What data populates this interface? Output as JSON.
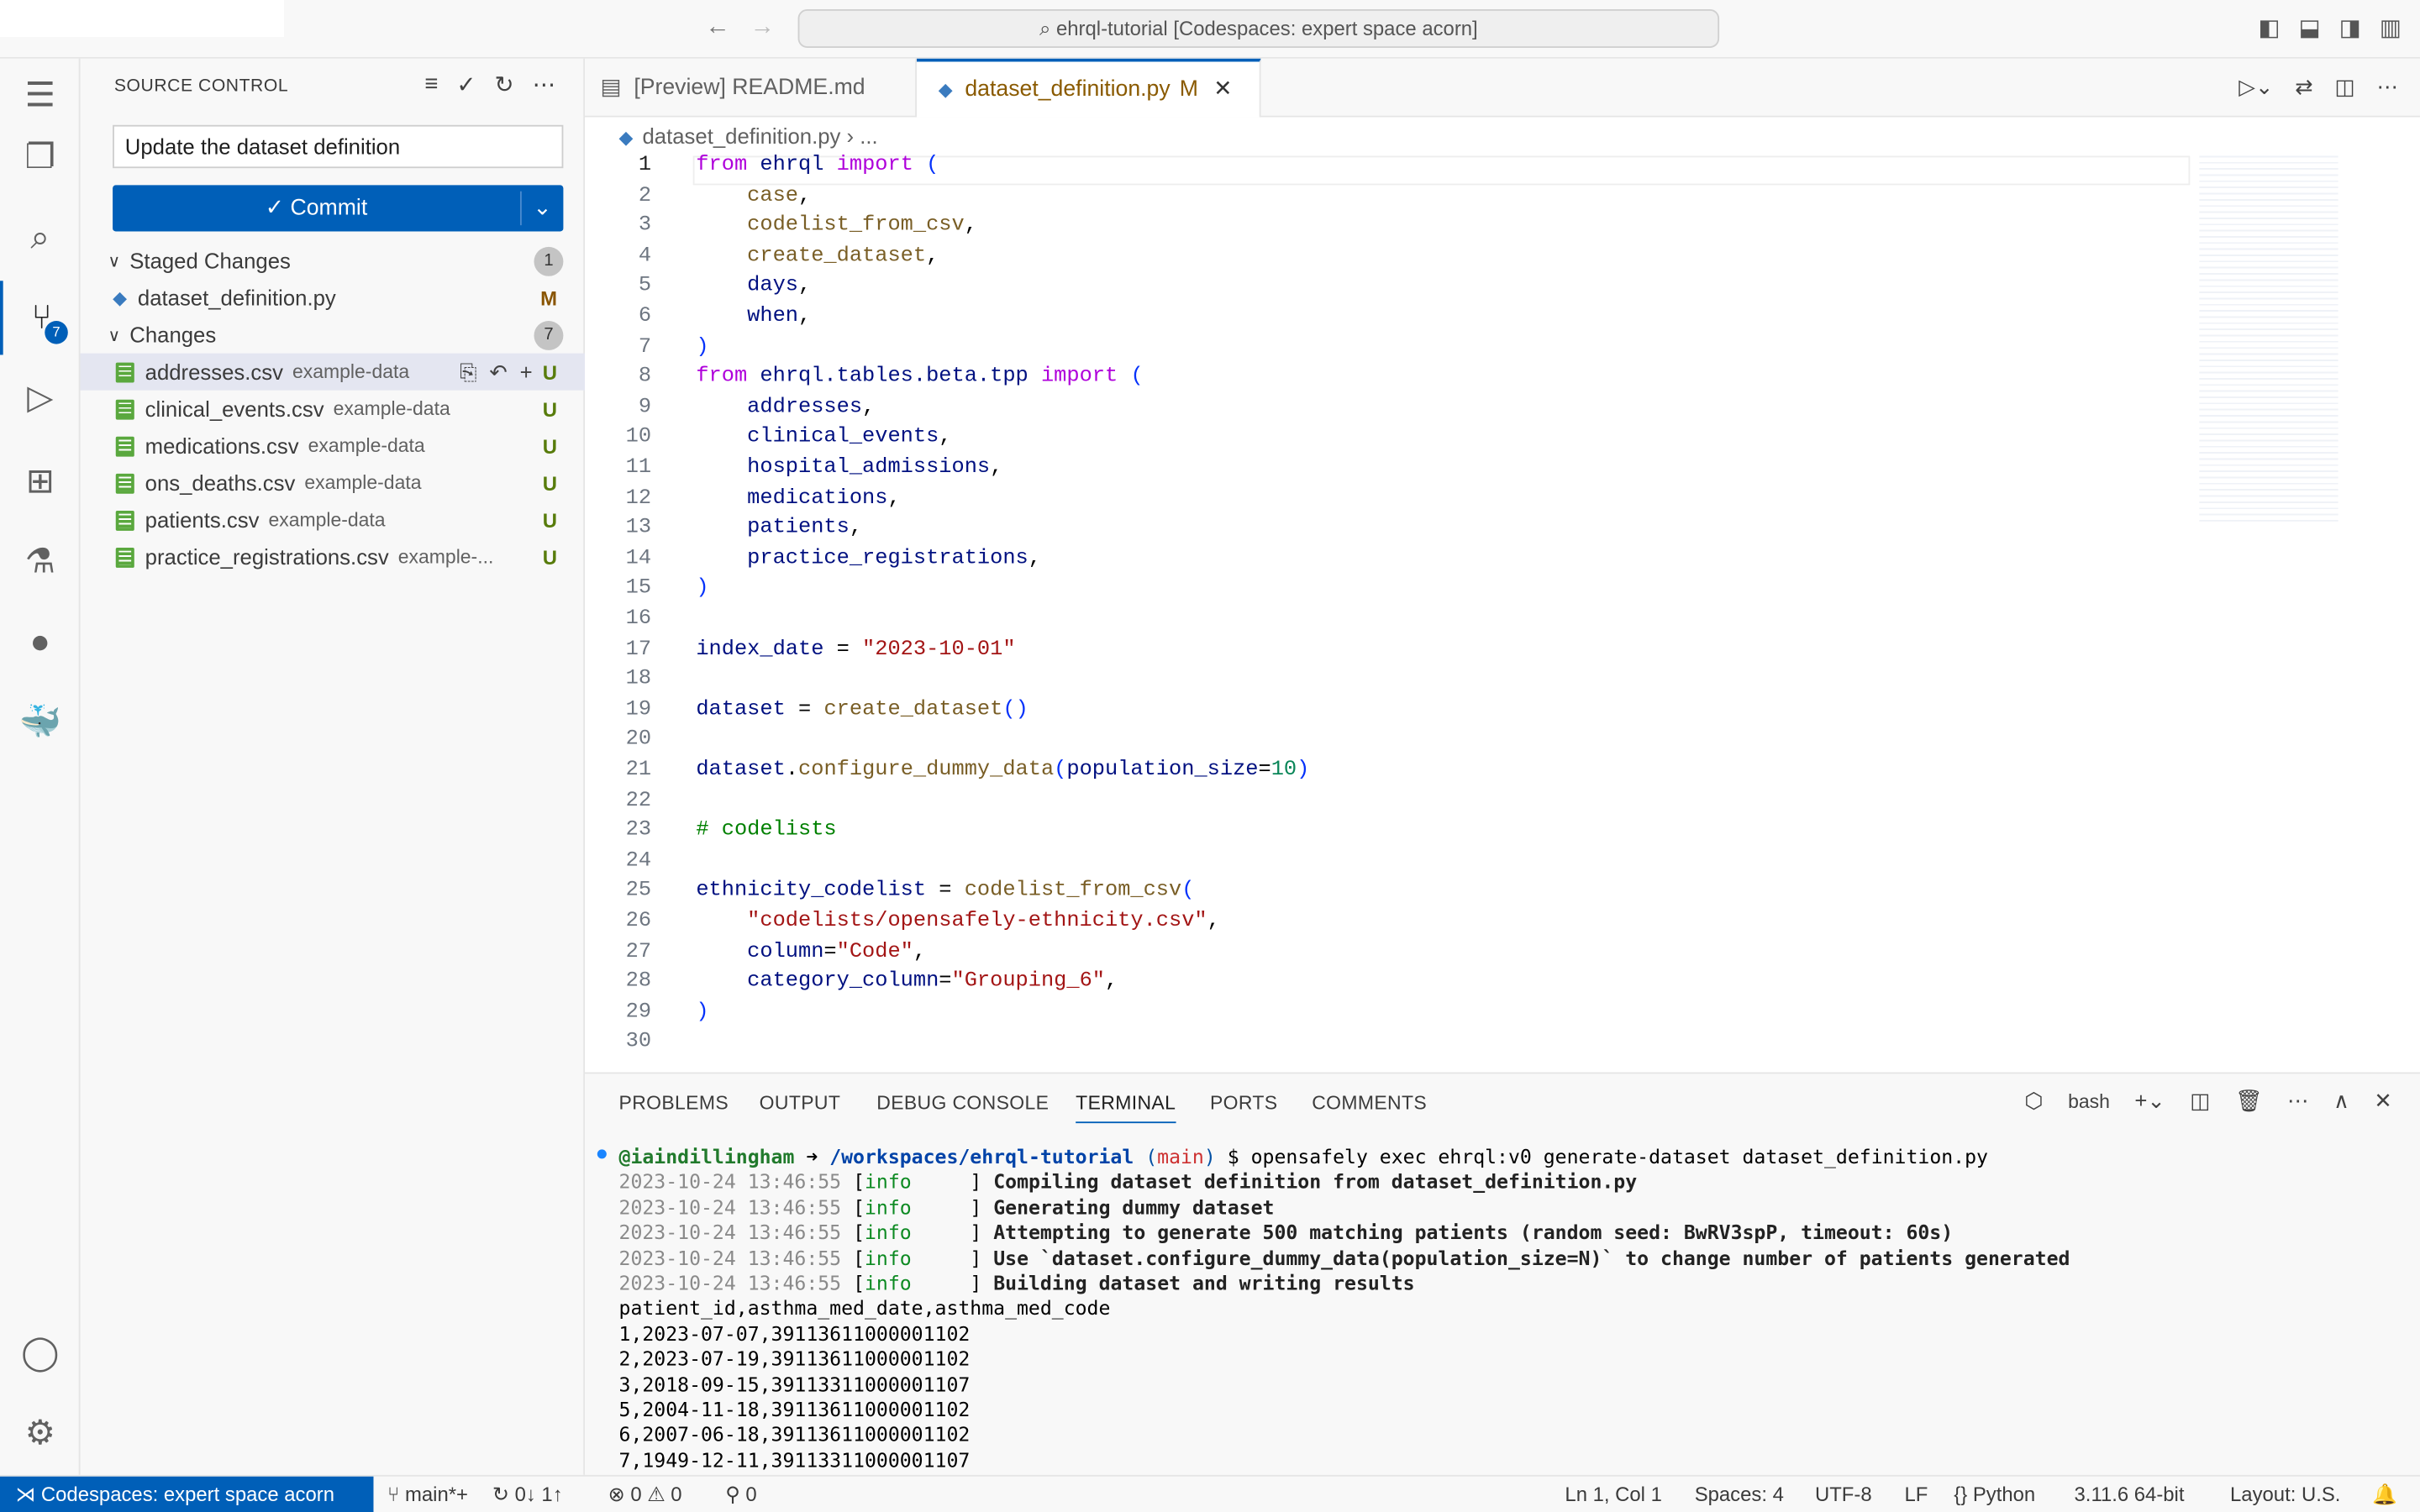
{
  "title_bar": {
    "search": "ehrql-tutorial [Codespaces: expert space acorn]"
  },
  "activity_bar": {
    "items": [
      "menu",
      "explorer",
      "search",
      "source-control",
      "run-debug",
      "extensions",
      "testing",
      "github",
      "docker",
      "accounts",
      "manage"
    ],
    "scm_badge": "7"
  },
  "sidebar": {
    "title": "SOURCE CONTROL",
    "commit_message": "Update the dataset definition",
    "commit_label": "Commit",
    "staged": {
      "label": "Staged Changes",
      "count": "1",
      "files": [
        {
          "name": "dataset_definition.py",
          "dir": "",
          "status": "M"
        }
      ]
    },
    "changes": {
      "label": "Changes",
      "count": "7",
      "files": [
        {
          "name": "addresses.csv",
          "dir": "example-data",
          "status": "U"
        },
        {
          "name": "clinical_events.csv",
          "dir": "example-data",
          "status": "U"
        },
        {
          "name": "medications.csv",
          "dir": "example-data",
          "status": "U"
        },
        {
          "name": "ons_deaths.csv",
          "dir": "example-data",
          "status": "U"
        },
        {
          "name": "patients.csv",
          "dir": "example-data",
          "status": "U"
        },
        {
          "name": "practice_registrations.csv",
          "dir": "example-...",
          "status": "U"
        }
      ]
    }
  },
  "tabs": [
    {
      "label": "[Preview] README.md"
    },
    {
      "label": "dataset_definition.py",
      "modified": "M"
    }
  ],
  "breadcrumb": {
    "file": "dataset_definition.py",
    "rest": "..."
  },
  "code": [
    [
      [
        "from ",
        "kw"
      ],
      [
        "ehrql ",
        "var"
      ],
      [
        "import ",
        "kw"
      ],
      [
        "(",
        "par"
      ]
    ],
    [
      [
        "    case",
        "fn"
      ],
      [
        ",",
        "pl"
      ]
    ],
    [
      [
        "    codelist_from_csv",
        "fn"
      ],
      [
        ",",
        "pl"
      ]
    ],
    [
      [
        "    create_dataset",
        "fn"
      ],
      [
        ",",
        "pl"
      ]
    ],
    [
      [
        "    days",
        "var"
      ],
      [
        ",",
        "pl"
      ]
    ],
    [
      [
        "    when",
        "var"
      ],
      [
        ",",
        "pl"
      ]
    ],
    [
      [
        ")",
        "par"
      ]
    ],
    [
      [
        "from ",
        "kw"
      ],
      [
        "ehrql.tables.beta.tpp ",
        "var"
      ],
      [
        "import ",
        "kw"
      ],
      [
        "(",
        "par"
      ]
    ],
    [
      [
        "    addresses",
        "var"
      ],
      [
        ",",
        "pl"
      ]
    ],
    [
      [
        "    clinical_events",
        "var"
      ],
      [
        ",",
        "pl"
      ]
    ],
    [
      [
        "    hospital_admissions",
        "var"
      ],
      [
        ",",
        "pl"
      ]
    ],
    [
      [
        "    medications",
        "var"
      ],
      [
        ",",
        "pl"
      ]
    ],
    [
      [
        "    patients",
        "var"
      ],
      [
        ",",
        "pl"
      ]
    ],
    [
      [
        "    practice_registrations",
        "var"
      ],
      [
        ",",
        "pl"
      ]
    ],
    [
      [
        ")",
        "par"
      ]
    ],
    [],
    [
      [
        "index_date",
        "var"
      ],
      [
        " = ",
        "pl"
      ],
      [
        "\"2023-10-01\"",
        "str"
      ]
    ],
    [],
    [
      [
        "dataset",
        "var"
      ],
      [
        " = ",
        "pl"
      ],
      [
        "create_dataset",
        "fn"
      ],
      [
        "()",
        "par"
      ]
    ],
    [],
    [
      [
        "dataset",
        "var"
      ],
      [
        ".",
        "pl"
      ],
      [
        "configure_dummy_data",
        "fn"
      ],
      [
        "(",
        "par"
      ],
      [
        "population_size",
        "var"
      ],
      [
        "=",
        "pl"
      ],
      [
        "10",
        "num"
      ],
      [
        ")",
        "par"
      ]
    ],
    [],
    [
      [
        "# codelists",
        "cm"
      ]
    ],
    [],
    [
      [
        "ethnicity_codelist",
        "var"
      ],
      [
        " = ",
        "pl"
      ],
      [
        "codelist_from_csv",
        "fn"
      ],
      [
        "(",
        "par"
      ]
    ],
    [
      [
        "    \"codelists/opensafely-ethnicity.csv\"",
        "str"
      ],
      [
        ",",
        "pl"
      ]
    ],
    [
      [
        "    column",
        "var"
      ],
      [
        "=",
        "pl"
      ],
      [
        "\"Code\"",
        "str"
      ],
      [
        ",",
        "pl"
      ]
    ],
    [
      [
        "    category_column",
        "var"
      ],
      [
        "=",
        "pl"
      ],
      [
        "\"Grouping_6\"",
        "str"
      ],
      [
        ",",
        "pl"
      ]
    ],
    [
      [
        ")",
        "par"
      ]
    ],
    []
  ],
  "panel": {
    "tabs": [
      "PROBLEMS",
      "OUTPUT",
      "DEBUG CONSOLE",
      "TERMINAL",
      "PORTS",
      "COMMENTS"
    ],
    "active_tab": "TERMINAL",
    "shell": "bash",
    "terminal": [
      [
        [
          "@iaindillingham",
          "ugreen"
        ],
        [
          " ➜ ",
          "pl"
        ],
        [
          "/workspaces/ehrql-tutorial",
          "blue"
        ],
        [
          " (",
          "bl"
        ],
        [
          "main",
          "red"
        ],
        [
          ")",
          "bl"
        ],
        [
          " $ opensafely exec ehrql:v0 generate-dataset dataset_definition.py",
          "pl"
        ]
      ],
      [
        [
          "2023-10-24 13:46:55 ",
          "grey"
        ],
        [
          "[",
          "pl"
        ],
        [
          "info     ",
          "green"
        ],
        [
          "] ",
          "pl"
        ],
        [
          "Compiling dataset definition from dataset_definition.py",
          "bold"
        ]
      ],
      [
        [
          "2023-10-24 13:46:55 ",
          "grey"
        ],
        [
          "[",
          "pl"
        ],
        [
          "info     ",
          "green"
        ],
        [
          "] ",
          "pl"
        ],
        [
          "Generating dummy dataset",
          "bold"
        ]
      ],
      [
        [
          "2023-10-24 13:46:55 ",
          "grey"
        ],
        [
          "[",
          "pl"
        ],
        [
          "info     ",
          "green"
        ],
        [
          "] ",
          "pl"
        ],
        [
          "Attempting to generate 500 matching patients (random seed: BwRV3spP, timeout: 60s)",
          "bold"
        ]
      ],
      [
        [
          "2023-10-24 13:46:55 ",
          "grey"
        ],
        [
          "[",
          "pl"
        ],
        [
          "info     ",
          "green"
        ],
        [
          "] ",
          "pl"
        ],
        [
          "Use `dataset.configure_dummy_data(population_size=N)` to change number of patients generated",
          "bold"
        ]
      ],
      [
        [
          "2023-10-24 13:46:55 ",
          "grey"
        ],
        [
          "[",
          "pl"
        ],
        [
          "info     ",
          "green"
        ],
        [
          "] ",
          "pl"
        ],
        [
          "Building dataset and writing results",
          "bold"
        ]
      ],
      [
        [
          "patient_id,asthma_med_date,asthma_med_code",
          "pl"
        ]
      ],
      [
        [
          "1,2023-07-07,39113611000001102",
          "pl"
        ]
      ],
      [
        [
          "2,2023-07-19,39113611000001102",
          "pl"
        ]
      ],
      [
        [
          "3,2018-09-15,39113311000001107",
          "pl"
        ]
      ],
      [
        [
          "5,2004-11-18,39113611000001102",
          "pl"
        ]
      ],
      [
        [
          "6,2007-06-18,39113611000001102",
          "pl"
        ]
      ],
      [
        [
          "7,1949-12-11,39113311000001107",
          "pl"
        ]
      ]
    ]
  },
  "status": {
    "remote": "Codespaces: expert space acorn",
    "branch": "main*+",
    "sync": "0↓ 1↑",
    "errors": "0",
    "warnings": "0",
    "ports": "0",
    "position": "Ln 1, Col 1",
    "spaces": "Spaces: 4",
    "encoding": "UTF-8",
    "eol": "LF",
    "language": "Python",
    "interpreter": "3.11.6 64-bit",
    "layout": "Layout: U.S."
  },
  "colors": {
    "accent": "#005fb8",
    "modified": "#895503",
    "untracked": "#587c0c"
  }
}
